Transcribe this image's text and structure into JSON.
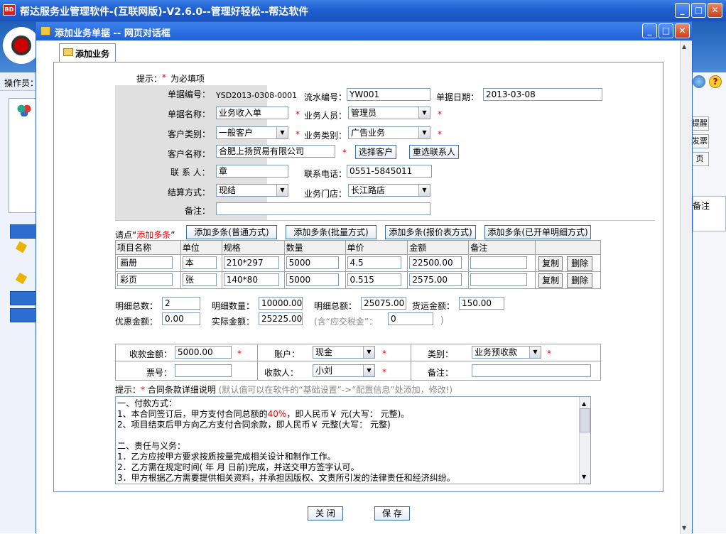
{
  "main_window": {
    "logo_text": "BD",
    "title": "帮达服务业管理软件-(互联网版)-V2.6.0--管理好轻松--帮达软件",
    "operator_label": "操作员：",
    "right_buttons": [
      "提醒",
      "发票",
      "页"
    ],
    "right_header": "备注",
    "controls": {
      "minimize": "_",
      "maximize": "□",
      "close": "✕"
    }
  },
  "dialog": {
    "title": "添加业务单据 -- 网页对话框",
    "tab": "添加业务",
    "hint_label": "提示：",
    "hint_text": "为必填项",
    "fields": {
      "bill_no_label": "单据编号：",
      "bill_no_value": "YSD2013-0308-0001",
      "serial_no_label": "流水编号：",
      "serial_no_value": "YW001",
      "bill_date_label": "单据日期：",
      "bill_date_value": "2013-03-08",
      "bill_name_label": "单据名称：",
      "bill_name_value": "业务收入单",
      "staff_label": "业务人员：",
      "staff_value": "管理员",
      "customer_type_label": "客户类别：",
      "customer_type_value": "一般客户",
      "business_type_label": "业务类别：",
      "business_type_value": "广告业务",
      "customer_name_label": "客户名称：",
      "customer_name_value": "合肥上扬贸易有限公司",
      "select_customer_btn": "选择客户",
      "reselect_contact_btn": "重选联系人",
      "contact_label": "联 系 人：",
      "contact_value": "章",
      "phone_label": "联系电话：",
      "phone_value": "0551-5845011",
      "settlement_label": "结算方式：",
      "settlement_value": "现结",
      "store_label": "业务门店：",
      "store_value": "长江路店",
      "remark_label": "备注：",
      "remark_value": ""
    },
    "add_multi": {
      "prompt_prefix": "请点“",
      "prompt_highlight": "添加多条",
      "prompt_suffix": "”",
      "buttons": [
        "添加多条(普通方式)",
        "添加多条(批量方式)",
        "添加多条(报价表方式)",
        "添加多条(已开单明细方式)"
      ]
    },
    "items_table": {
      "headers": [
        "项目名称",
        "单位",
        "规格",
        "数量",
        "单价",
        "金额",
        "备注",
        ""
      ],
      "rows": [
        {
          "name": "画册",
          "unit": "本",
          "spec": "210*297",
          "qty": "5000",
          "price": "4.5",
          "amount": "22500.00",
          "remark": ""
        },
        {
          "name": "彩页",
          "unit": "张",
          "spec": "140*80",
          "qty": "5000",
          "price": "0.515",
          "amount": "2575.00",
          "remark": ""
        }
      ],
      "copy_btn": "复制",
      "delete_btn": "删除"
    },
    "totals": {
      "detail_count_label": "明细总数：",
      "detail_count_value": "2",
      "detail_qty_label": "明细数量：",
      "detail_qty_value": "10000.000",
      "detail_amount_label": "明细总额：",
      "detail_amount_value": "25075.00",
      "freight_label": "货运金额：",
      "freight_value": "150.00",
      "discount_label": "优惠金额：",
      "discount_value": "0.00",
      "actual_label": "实际金额：",
      "actual_value": "25225.00",
      "tax_prefix": "(含“应交税金”：",
      "tax_value": "0",
      "tax_suffix": ")"
    },
    "payment": {
      "received_label": "收款金额：",
      "received_value": "5000.00",
      "account_label": "账户：",
      "account_value": "现金",
      "category_label": "类别：",
      "category_value": "业务预收款",
      "ticket_label": "票号：",
      "ticket_value": "",
      "payee_label": "收款人：",
      "payee_value": "小刘",
      "remark_label": "备注：",
      "remark_value": ""
    },
    "contract": {
      "hint_label": "提示：",
      "hint_title": "合同条款详细说明",
      "hint_note": "(默认值可以在软件的“基础设置”->“配置信息”处添加，修改!)",
      "lines": [
        "一、付款方式：",
        "1、本合同签订后，甲方支付合同总额的40%，即人民币￥  元(大写：   元整)。",
        "2、项目结束后甲方向乙方支付合同余款，即人民币￥  元整(大写：   元整)",
        "",
        "二、责任与义务：",
        "1．乙方应按甲方要求按质按量完成相关设计和制作工作。",
        "2．乙方需在规定时间(   年   月   日前)完成，并送交甲方签字认可。",
        "3．甲方根据乙方需要提供相关资料，并承担因版权、文责所引发的法律责任和经济纠纷。"
      ]
    },
    "footer": {
      "close_btn": "关 闭",
      "save_btn": "保 存"
    },
    "controls": {
      "minimize": "_",
      "maximize": "□",
      "close": "✕"
    },
    "required_mark": "*"
  }
}
